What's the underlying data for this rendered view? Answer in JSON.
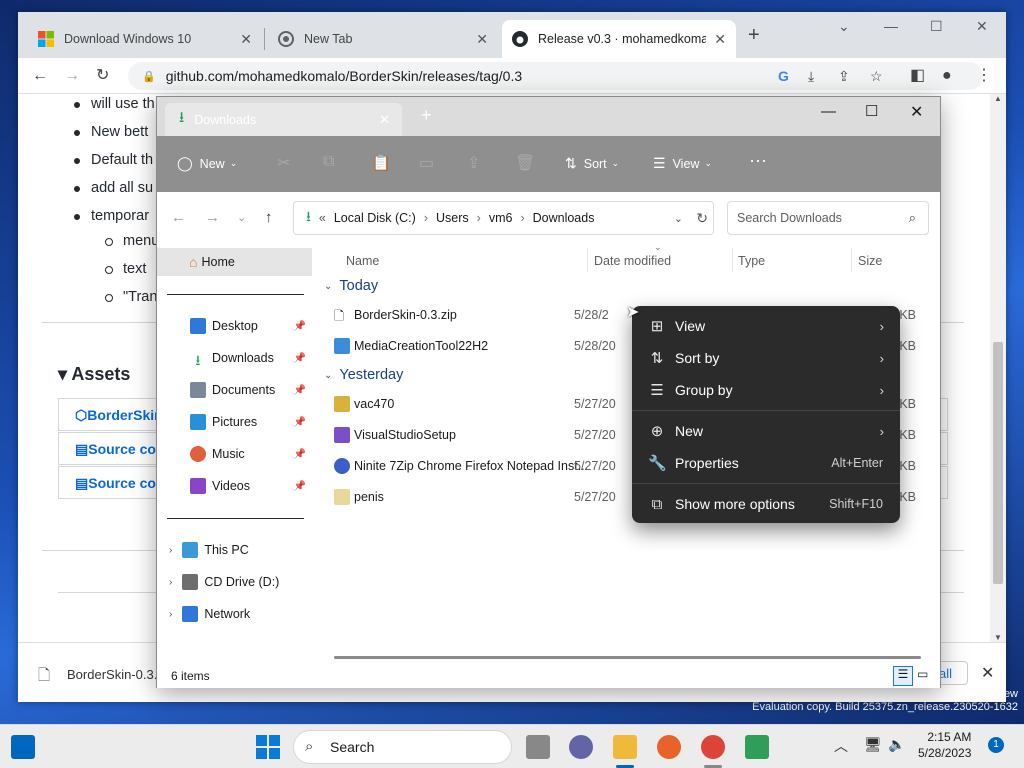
{
  "browser": {
    "tabs": [
      {
        "label": "Download Windows 10"
      },
      {
        "label": "New Tab"
      },
      {
        "label": "Release v0.3 · mohamedkomalo"
      }
    ],
    "url": "github.com/mohamedkomalo/BorderSkin/releases/tag/0.3"
  },
  "page": {
    "bullets": [
      "will use th",
      "New bett",
      "Default th",
      "add all su",
      "temporar"
    ],
    "sub_bullets": [
      "menu",
      "text",
      "\"Tran"
    ],
    "assets_heading": "Assets",
    "assets": [
      "BorderSkin",
      "Source co",
      "Source co"
    ]
  },
  "download_bar": {
    "file": "BorderSkin-0.3.z",
    "show_all": "all"
  },
  "explorer": {
    "tab_title": "Downloads",
    "commands": {
      "new": "New",
      "sort": "Sort",
      "view": "View"
    },
    "breadcrumb": {
      "root": "Local Disk (C:)",
      "users": "Users",
      "user": "vm6",
      "folder": "Downloads"
    },
    "search_placeholder": "Search Downloads",
    "nav": {
      "home": "Home",
      "quick": [
        {
          "label": "Desktop",
          "color": "#2f78d8"
        },
        {
          "label": "Downloads",
          "color": "#1c9e5a"
        },
        {
          "label": "Documents",
          "color": "#7a8899"
        },
        {
          "label": "Pictures",
          "color": "#2a8ed8"
        },
        {
          "label": "Music",
          "color": "#e0603a"
        },
        {
          "label": "Videos",
          "color": "#8a44c8"
        }
      ],
      "this_pc": "This PC",
      "cd_drive": "CD Drive (D:)",
      "network": "Network"
    },
    "columns": {
      "name": "Name",
      "date": "Date modified",
      "type": "Type",
      "size": "Size"
    },
    "groups": [
      {
        "label": "Today",
        "files": [
          {
            "name": "BorderSkin-0.3.zip",
            "date": "5/28/2",
            "size": "9 KB"
          },
          {
            "name": "MediaCreationTool22H2",
            "date": "5/28/20",
            "size": "8 KB"
          }
        ]
      },
      {
        "label": "Yesterday",
        "files": [
          {
            "name": "vac470",
            "date": "5/27/20",
            "size": "7 KB"
          },
          {
            "name": "VisualStudioSetup",
            "date": "5/27/20",
            "size": "7 KB"
          },
          {
            "name": "Ninite 7Zip Chrome Firefox Notepad Inst...",
            "date": "5/27/20",
            "size": "6 KB"
          },
          {
            "name": "penis",
            "date": "5/27/20",
            "size": "3 KB"
          }
        ]
      }
    ],
    "status": "6 items"
  },
  "context_menu": {
    "view": "View",
    "sort_by": "Sort by",
    "group_by": "Group by",
    "new": "New",
    "properties": "Properties",
    "properties_shortcut": "Alt+Enter",
    "more": "Show more options",
    "more_shortcut": "Shift+F10"
  },
  "taskbar": {
    "search": "Search",
    "time": "2:15 AM",
    "date": "5/28/2023",
    "notifications": "1"
  },
  "watermark": {
    "line1": "ew",
    "line2": "Evaluation copy. Build 25375.zn_release.230520-1632"
  }
}
